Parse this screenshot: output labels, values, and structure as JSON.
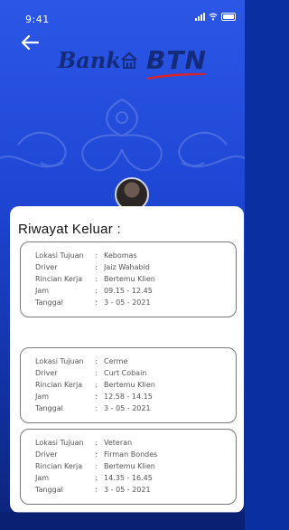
{
  "status_bar": {
    "time": "9:41"
  },
  "logo": {
    "bank": "Bank",
    "btn": "BTN"
  },
  "section_title": "Riwayat Keluar :",
  "labels": {
    "lokasi": "Lokasi Tujuan",
    "driver": "Driver",
    "rincian": "Rincian Kerja",
    "jam": "Jam",
    "tanggal": "Tanggal",
    "sep": ":"
  },
  "records": [
    {
      "lokasi": "Kebomas",
      "driver": "Jaiz Wahabid",
      "rincian": "Bertemu Klien",
      "jam": "09.15 - 12.45",
      "tanggal": "3 - 05 - 2021"
    },
    {
      "lokasi": "Cerme",
      "driver": "Curt Cobain",
      "rincian": "Bertemu Klien",
      "jam": "12.58 - 14.15",
      "tanggal": "3 - 05 - 2021"
    },
    {
      "lokasi": "Veteran",
      "driver": "Firman Bondes",
      "rincian": "Bertemu Klien",
      "jam": "14.35 - 16.45",
      "tanggal": "3 - 05 - 2021"
    }
  ],
  "icons": [
    "back-arrow-icon",
    "signal-icon",
    "wifi-icon",
    "battery-icon",
    "btn-logo-icon"
  ],
  "colors": {
    "primary": "#1f47d6",
    "logo_text": "#142a7a",
    "accent_red": "#d8232a"
  }
}
